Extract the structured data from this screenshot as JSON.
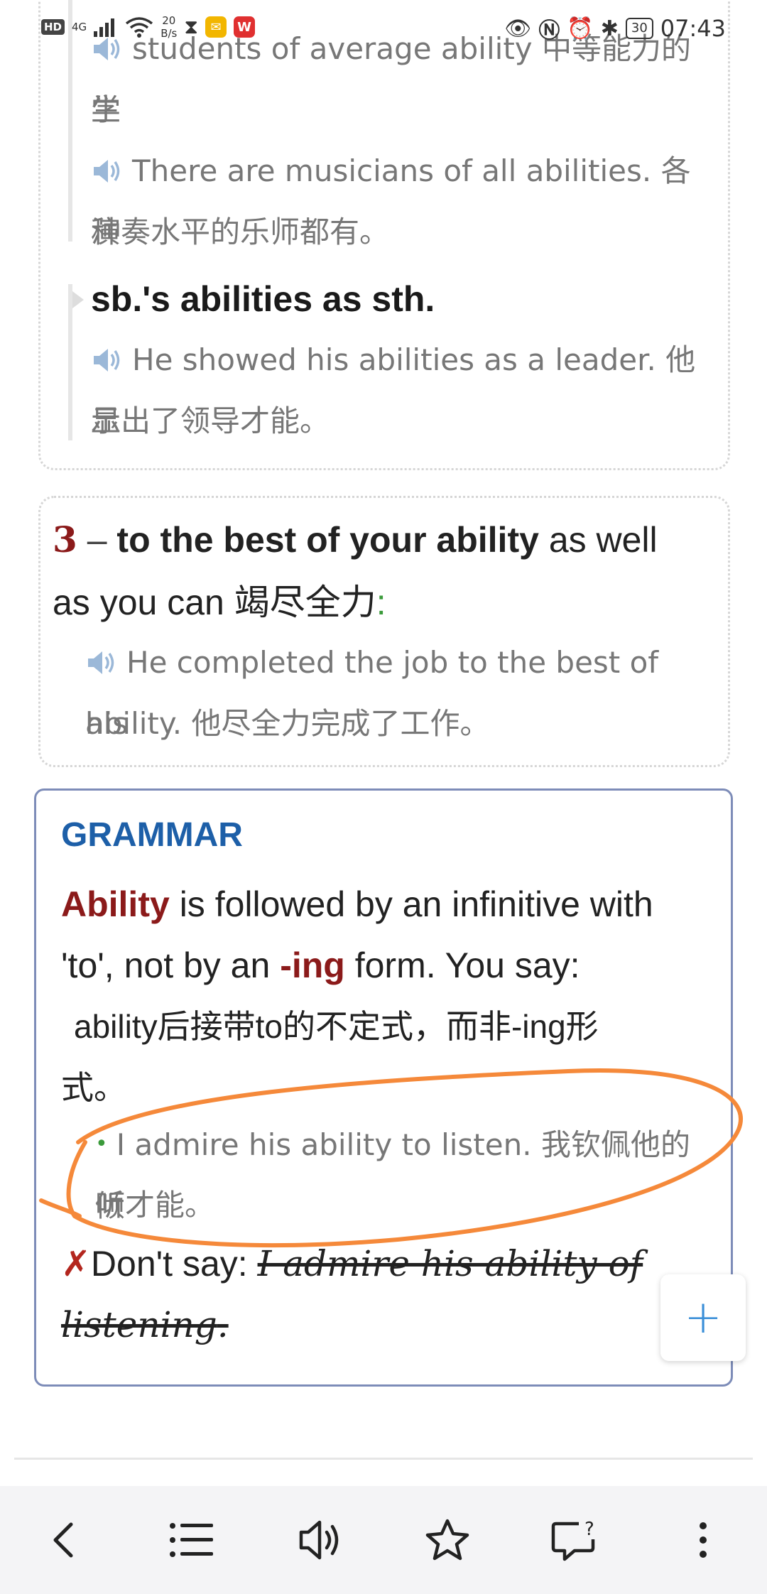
{
  "status_bar": {
    "hd": "HD",
    "signal": "4G",
    "net_speed_top": "20",
    "net_speed_bottom": "B/s",
    "battery": "30",
    "time": "07:43"
  },
  "top_card": {
    "example1_en": "students of average ability",
    "example1_zh": "中等能力的学",
    "example1_zh_cont": "生",
    "example2_en": "There are musicians of all abilities.",
    "example2_zh": "各种",
    "example2_zh_cont": "演奏水平的乐师都有。",
    "pattern": "sb.'s abilities as sth.",
    "example3_en": "He showed his abilities as a leader.",
    "example3_zh": "他显",
    "example3_zh_cont": "示出了领导才能。"
  },
  "sense3": {
    "number": "3",
    "dash": "–",
    "phrase": "to the best of your ability",
    "definition_part1": "as well",
    "definition_part2": "as you can",
    "definition_zh": "竭尽全力",
    "colon": ":",
    "example_en_line1": "He completed the job to the best of his",
    "example_en_line2": "ability.",
    "example_zh": "他尽全力完成了工作。"
  },
  "grammar": {
    "title": "GRAMMAR",
    "word": "Ability",
    "text1": " is followed by an infinitive with",
    "text2a": "'to', not by an ",
    "ing": "-ing",
    "text2b": " form. You say:",
    "zh_line1": "ability后接带to的不定式，而非-ing形",
    "zh_line2": "式。",
    "example_en": "I admire his ability to listen.",
    "example_zh": "我钦佩他的倾",
    "example_zh_cont": "听才能。",
    "cross": "✗",
    "dont_say": "Don't say: ",
    "wrong_line1": "I admire his ability of",
    "wrong_line2": "listening",
    "wrong_end": "."
  },
  "fab": {
    "label": "+"
  },
  "colors": {
    "accent_blue": "#1d5fa8",
    "dark_red": "#8b1a1a",
    "annotation_orange": "#f5893a",
    "green": "#3a9a3a"
  },
  "bottom_nav": [
    "back-icon",
    "list-icon",
    "speaker-icon",
    "star-icon",
    "feedback-icon",
    "more-icon"
  ]
}
